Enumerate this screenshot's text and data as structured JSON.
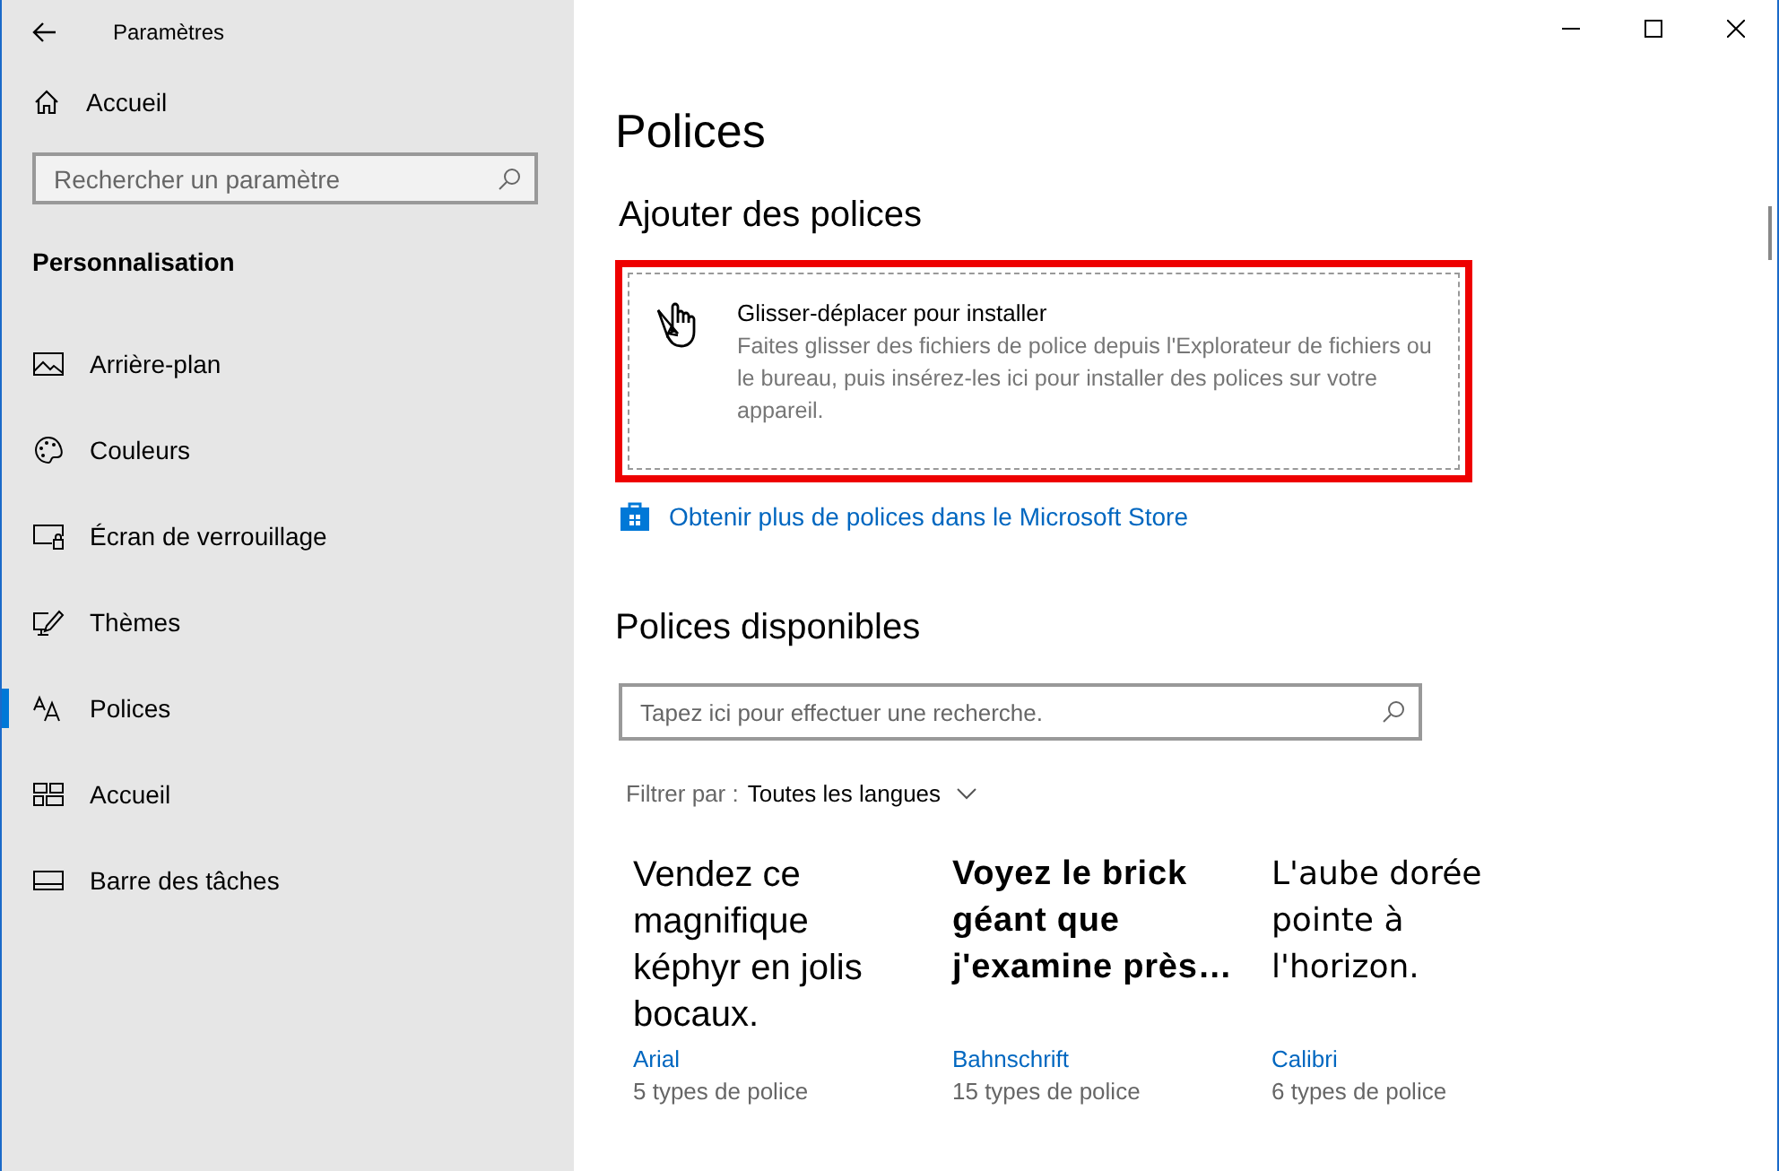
{
  "window": {
    "title": "Paramètres"
  },
  "sidebar": {
    "home": "Accueil",
    "search": {
      "placeholder": "Rechercher un paramètre"
    },
    "section": "Personnalisation",
    "items": [
      {
        "label": "Arrière-plan",
        "selected": false
      },
      {
        "label": "Couleurs",
        "selected": false
      },
      {
        "label": "Écran de verrouillage",
        "selected": false
      },
      {
        "label": "Thèmes",
        "selected": false
      },
      {
        "label": "Polices",
        "selected": true
      },
      {
        "label": "Accueil",
        "selected": false
      },
      {
        "label": "Barre des tâches",
        "selected": false
      }
    ]
  },
  "page": {
    "title": "Polices",
    "add_heading": "Ajouter des polices",
    "drop_zone": {
      "highlighted": true,
      "title": "Glisser-déplacer pour installer",
      "text": "Faites glisser des fichiers de police depuis l'Explorateur de fichiers ou le bureau, puis insérez-les ici pour installer des polices sur votre appareil."
    },
    "store_link": "Obtenir plus de polices dans le Microsoft Store",
    "available_heading": "Polices disponibles",
    "search": {
      "placeholder": "Tapez ici pour effectuer une recherche."
    },
    "filter": {
      "label": "Filtrer par :",
      "value": "Toutes les langues"
    },
    "fonts": [
      {
        "preview": "Vendez ce magnifique képhyr en jolis bocaux.",
        "name": "Arial",
        "count": "5 types de police"
      },
      {
        "preview": "Voyez le brick géant que j'examine près…",
        "name": "Bahnschrift",
        "count": "15 types de police"
      },
      {
        "preview": "L'aube dorée pointe à l'horizon.",
        "name": "Calibri",
        "count": "6 types de police"
      }
    ]
  }
}
